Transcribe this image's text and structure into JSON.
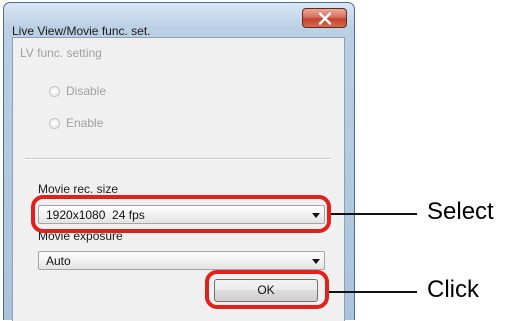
{
  "dialog": {
    "title": "Live View/Movie func. set.",
    "lv_group": {
      "label": "LV func. setting",
      "options": [
        "Disable",
        "Enable"
      ]
    },
    "movie_rec_size": {
      "label": "Movie rec. size",
      "value": "1920x1080  24 fps"
    },
    "movie_exposure": {
      "label": "Movie exposure",
      "value": "Auto"
    },
    "ok_label": "OK"
  },
  "annotations": {
    "select": "Select",
    "click": "Click",
    "callout_color": "#e2211c"
  },
  "icons": {
    "close": "close-icon",
    "dropdown": "chevron-down-icon"
  }
}
